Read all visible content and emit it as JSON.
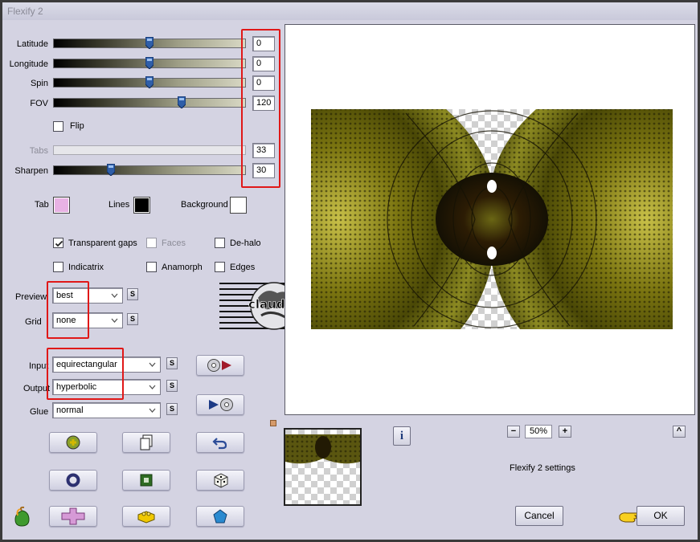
{
  "window": {
    "title": "Flexify 2"
  },
  "sliders": [
    {
      "label": "Latitude",
      "value": "0",
      "fraction": 0.5
    },
    {
      "label": "Longitude",
      "value": "0",
      "fraction": 0.5
    },
    {
      "label": "Spin",
      "value": "0",
      "fraction": 0.5
    },
    {
      "label": "FOV",
      "value": "120",
      "fraction": 0.67
    },
    {
      "label": "Tabs",
      "value": "33",
      "fraction": 0.0,
      "disabled": true
    },
    {
      "label": "Sharpen",
      "value": "30",
      "fraction": 0.3
    }
  ],
  "flip": {
    "label": "Flip",
    "checked": false
  },
  "colors": {
    "tab": {
      "label": "Tab",
      "hex": "#e8b2e4"
    },
    "lines": {
      "label": "Lines",
      "hex": "#000000"
    },
    "background": {
      "label": "Background",
      "hex": "#ffffff"
    }
  },
  "options": {
    "transparent_gaps": {
      "label": "Transparent gaps",
      "checked": true
    },
    "faces": {
      "label": "Faces",
      "checked": false,
      "disabled": true
    },
    "de_halo": {
      "label": "De-halo",
      "checked": false
    },
    "indicatrix": {
      "label": "Indicatrix",
      "checked": false
    },
    "anamorph": {
      "label": "Anamorph",
      "checked": false
    },
    "edges": {
      "label": "Edges",
      "checked": false
    }
  },
  "dropdowns": {
    "preview": {
      "label": "Preview",
      "value": "best"
    },
    "grid": {
      "label": "Grid",
      "value": "none"
    },
    "input": {
      "label": "Input",
      "value": "equirectangular"
    },
    "output": {
      "label": "Output",
      "value": "hyperbolic"
    },
    "glue": {
      "label": "Glue",
      "value": "normal"
    }
  },
  "s_button_label": "S",
  "watermark": {
    "text": "claudia"
  },
  "zoom": {
    "value": "50%",
    "minus": "−",
    "plus": "+"
  },
  "settings_name": "Flexify 2 settings",
  "buttons": {
    "cancel": "Cancel",
    "ok": "OK",
    "collapse": "^",
    "info": "i"
  },
  "icons": {
    "tool_grid": [
      "puzzle-ball-icon",
      "page-copy-icon",
      "undo-arrow-icon",
      "ring-icon",
      "green-square-icon",
      "dice-icon",
      "pink-cross-icon",
      "yellow-brick-icon",
      "pentagon-icon"
    ]
  },
  "colors_theme": {
    "dialog": "#d4d3e2",
    "highlight": "#e01818",
    "olive": "#6b6a16"
  }
}
